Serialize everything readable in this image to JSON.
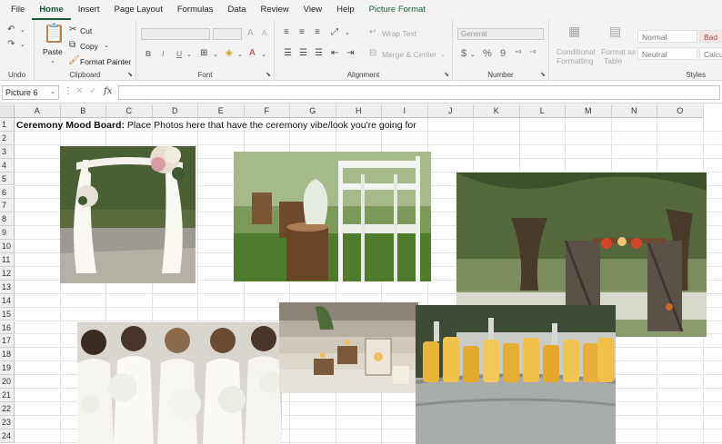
{
  "menu": {
    "tabs": [
      "File",
      "Home",
      "Insert",
      "Page Layout",
      "Formulas",
      "Data",
      "Review",
      "View",
      "Help",
      "Picture Format"
    ],
    "active": "Home",
    "context_tab": "Picture Format"
  },
  "ribbon": {
    "undo": {
      "label": "Undo"
    },
    "clipboard": {
      "label": "Clipboard",
      "paste": "Paste",
      "cut": "Cut",
      "copy": "Copy",
      "format_painter": "Format Painter"
    },
    "font": {
      "label": "Font",
      "grow": "A",
      "shrink": "A",
      "bold": "B",
      "italic": "I",
      "underline": "U"
    },
    "alignment": {
      "label": "Alignment",
      "wrap_text": "Wrap Text",
      "merge_center": "Merge & Center"
    },
    "number": {
      "label": "Number",
      "format": "General",
      "currency": "$",
      "percent": "%",
      "comma": "9"
    },
    "styles": {
      "label": "Styles",
      "conditional_1": "Conditional",
      "conditional_2": "Formatting",
      "format_table_1": "Format as",
      "format_table_2": "Table",
      "normal": "Normal",
      "bad": "Bad",
      "neutral": "Neutral",
      "calc": "Calcu"
    }
  },
  "formula_bar": {
    "name_box": "Picture 6",
    "fx": "fx",
    "cancel": "✕",
    "enter": "✓",
    "menu": "⋮"
  },
  "grid": {
    "columns": [
      "A",
      "B",
      "C",
      "D",
      "E",
      "F",
      "G",
      "H",
      "I",
      "J",
      "K",
      "L",
      "M",
      "N",
      "O"
    ],
    "rows": [
      "1",
      "2",
      "3",
      "4",
      "5",
      "6",
      "7",
      "8",
      "9",
      "10",
      "11",
      "12",
      "13",
      "14",
      "15",
      "16",
      "17",
      "18",
      "19",
      "20",
      "21",
      "22",
      "23",
      "24"
    ],
    "a1_bold": "Ceremony Mood Board:",
    "a1_rest": " Place Photos here that have the ceremony vibe/look you're going for"
  },
  "colors": {
    "accent": "#185c37"
  }
}
